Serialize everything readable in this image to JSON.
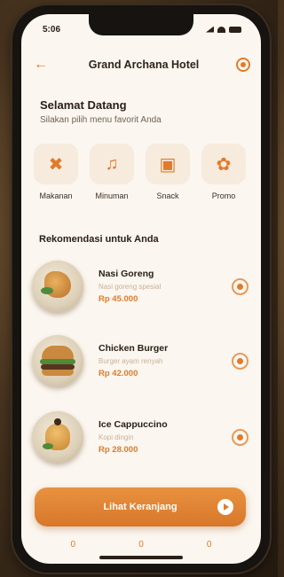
{
  "status": {
    "time": "5:06"
  },
  "header": {
    "title": "Grand Archana Hotel",
    "back_icon": "arrow-left-icon",
    "settings_icon": "settings-icon"
  },
  "greeting": {
    "title": "Selamat Datang",
    "subtitle": "Silakan pilih menu favorit Anda"
  },
  "categories": [
    {
      "label": "Makanan",
      "icon": "utensils-icon"
    },
    {
      "label": "Minuman",
      "icon": "chef-hat-icon"
    },
    {
      "label": "Snack",
      "icon": "snack-icon"
    },
    {
      "label": "Promo",
      "icon": "promo-icon"
    }
  ],
  "recommendations": {
    "title": "Rekomendasi untuk Anda",
    "items": [
      {
        "name": "Nasi Goreng",
        "desc": "Nasi goreng spesial",
        "price": "Rp 45.000"
      },
      {
        "name": "Chicken Burger",
        "desc": "Burger ayam renyah",
        "price": "Rp 42.000"
      },
      {
        "name": "Ice Cappuccino",
        "desc": "Kopi dingin",
        "price": "Rp 28.000"
      }
    ]
  },
  "cart_button": {
    "label": "Lihat Keranjang"
  },
  "tabbar": [
    {
      "label": "0"
    },
    {
      "label": "0"
    },
    {
      "label": "0"
    }
  ],
  "colors": {
    "accent": "#e07b2c",
    "background": "#fbf6ef",
    "text": "#2a2017"
  }
}
